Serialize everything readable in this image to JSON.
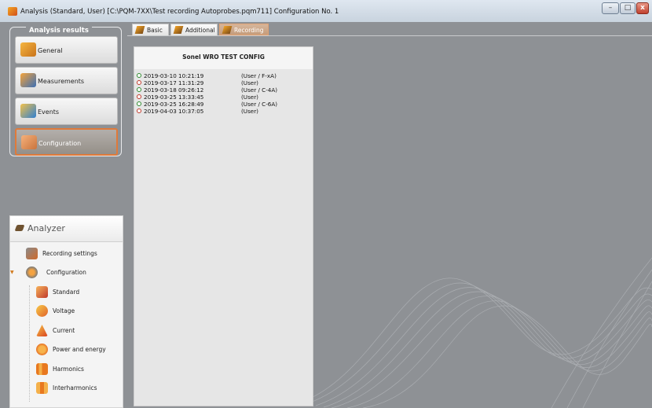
{
  "window": {
    "title": "Analysis (Standard, User) [C:\\PQM-7XX\\Test recording Autoprobes.pqm711] Configuration No. 1",
    "controls": {
      "minimize": "–",
      "maximize": "□",
      "close": "x"
    }
  },
  "sidebar": {
    "group_label": "Analysis results",
    "buttons": [
      {
        "label": "General",
        "icon": "general-icon"
      },
      {
        "label": "Measurements",
        "icon": "measurements-icon"
      },
      {
        "label": "Events",
        "icon": "events-icon"
      },
      {
        "label": "Configuration",
        "icon": "configuration-icon",
        "active": true
      }
    ]
  },
  "analyzer": {
    "title": "Analyzer",
    "items": [
      {
        "label": "Recording settings",
        "icon": "recording-settings-icon"
      },
      {
        "label": "Configuration",
        "icon": "configuration-icon",
        "expanded": true
      },
      {
        "label": "Standard",
        "icon": "standard-icon"
      },
      {
        "label": "Voltage",
        "icon": "voltage-icon"
      },
      {
        "label": "Current",
        "icon": "current-icon"
      },
      {
        "label": "Power and energy",
        "icon": "power-energy-icon"
      },
      {
        "label": "Harmonics",
        "icon": "harmonics-icon"
      },
      {
        "label": "Interharmonics",
        "icon": "interharmonics-icon"
      }
    ]
  },
  "tabs": [
    {
      "label": "Basic"
    },
    {
      "label": "Additional"
    },
    {
      "label": "Recording",
      "active": true
    }
  ],
  "config": {
    "title": "Sonel WRO TEST CONFIG",
    "records": [
      {
        "datetime": "2019-03-10 10:21:19",
        "mode": "(User / F-xA)",
        "status": "green"
      },
      {
        "datetime": "2019-03-17 11:31:29",
        "mode": "(User)",
        "status": "red"
      },
      {
        "datetime": "2019-03-18 09:26:12",
        "mode": "(User / C-4A)",
        "status": "green"
      },
      {
        "datetime": "2019-03-25 13:33:45",
        "mode": "(User)",
        "status": "red"
      },
      {
        "datetime": "2019-03-25 16:28:49",
        "mode": "(User / C-6A)",
        "status": "green"
      },
      {
        "datetime": "2019-04-03 10:37:05",
        "mode": "(User)",
        "status": "red"
      }
    ]
  },
  "colors": {
    "accent": "#e07a3a",
    "background": "#8e9195",
    "status_green": "#2e8a2e",
    "status_red": "#c0392b"
  }
}
